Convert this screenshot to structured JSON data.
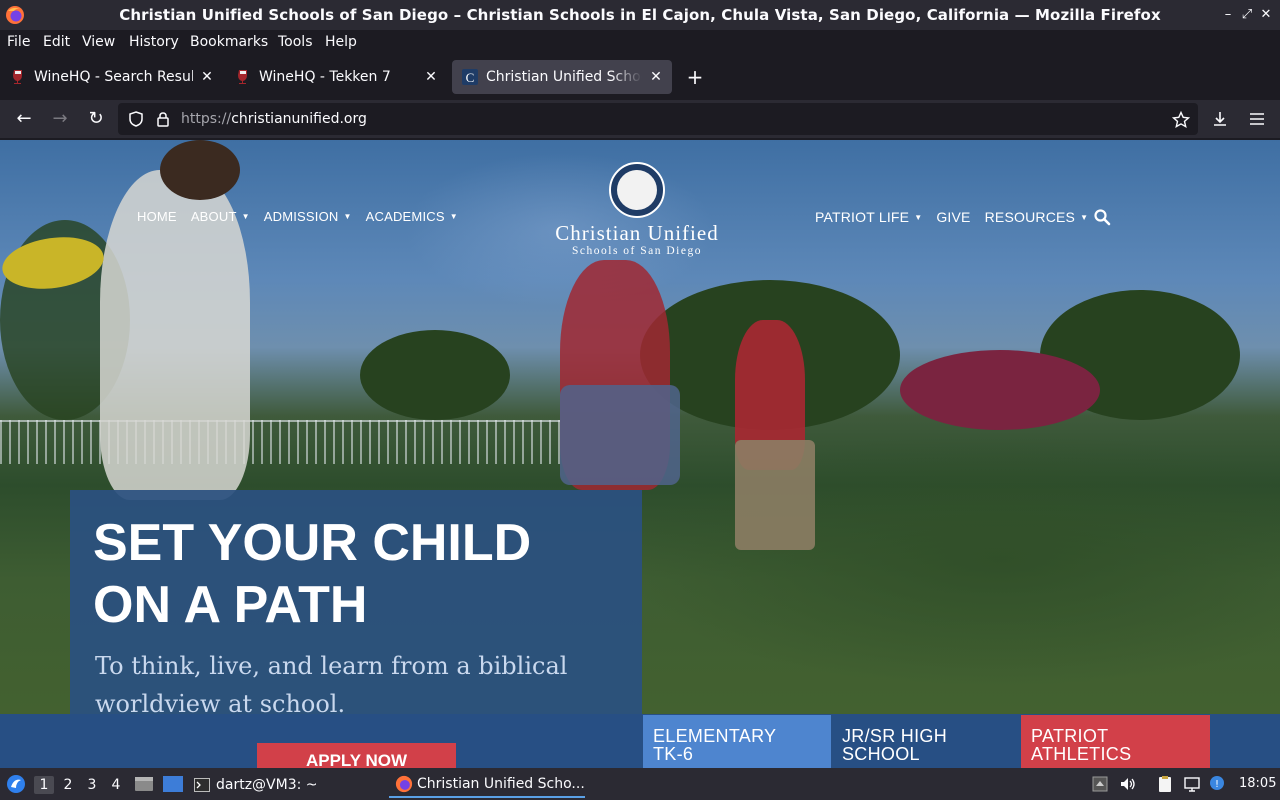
{
  "window": {
    "title": "Christian Unified Schools of San Diego – Christian Schools in El Cajon, Chula Vista, San Diego, California — Mozilla Firefox",
    "controls": [
      "minimize-icon",
      "maximize-icon",
      "close-icon"
    ]
  },
  "menubar": {
    "items": [
      "File",
      "Edit",
      "View",
      "History",
      "Bookmarks",
      "Tools",
      "Help"
    ]
  },
  "tabs": [
    {
      "label": "WineHQ - Search Results",
      "icon": "winehq-favicon",
      "active": false
    },
    {
      "label": "WineHQ - Tekken 7",
      "icon": "winehq-favicon",
      "active": false
    },
    {
      "label": "Christian Unified Schools",
      "icon": "cus-favicon",
      "active": true
    }
  ],
  "navbar": {
    "url_protocol": "https://",
    "url_host": "christianunified.org"
  },
  "site": {
    "nav_left": [
      {
        "label": "HOME",
        "dropdown": false
      },
      {
        "label": "ABOUT",
        "dropdown": true
      },
      {
        "label": "ADMISSION",
        "dropdown": true
      },
      {
        "label": "ACADEMICS",
        "dropdown": true
      }
    ],
    "nav_right": [
      {
        "label": "PATRIOT LIFE",
        "dropdown": true
      },
      {
        "label": "GIVE",
        "dropdown": false
      },
      {
        "label": "RESOURCES",
        "dropdown": true
      }
    ],
    "logo_line1": "Christian Unified",
    "logo_line2": "Schools of San Diego",
    "headline_line1": "SET YOUR CHILD",
    "headline_line2": "ON A PATH",
    "subhead": "To think, live, and learn from a biblical worldview at school.",
    "apply_label": "APPLY NOW",
    "cards": [
      {
        "line1": "ELEMENTARY",
        "line2": "TK-6",
        "color": "#4e85cf"
      },
      {
        "line1": "JR/SR HIGH",
        "line2": "SCHOOL",
        "color": "#274f84"
      },
      {
        "line1": "PATRIOT",
        "line2": "ATHLETICS",
        "color": "#d24049"
      }
    ]
  },
  "taskbar": {
    "workspaces": [
      "1",
      "2",
      "3",
      "4"
    ],
    "active_workspace": "1",
    "tasks": [
      {
        "label": "dartz@VM3: ~",
        "icon": "terminal-icon"
      },
      {
        "label": "Christian Unified Scho...",
        "icon": "firefox-icon"
      }
    ],
    "clock": "18:05"
  },
  "colors": {
    "accent_blue": "#4e85cf",
    "navy": "#274f84",
    "brand_red": "#d24049",
    "browser_chrome": "#2b2a33"
  }
}
